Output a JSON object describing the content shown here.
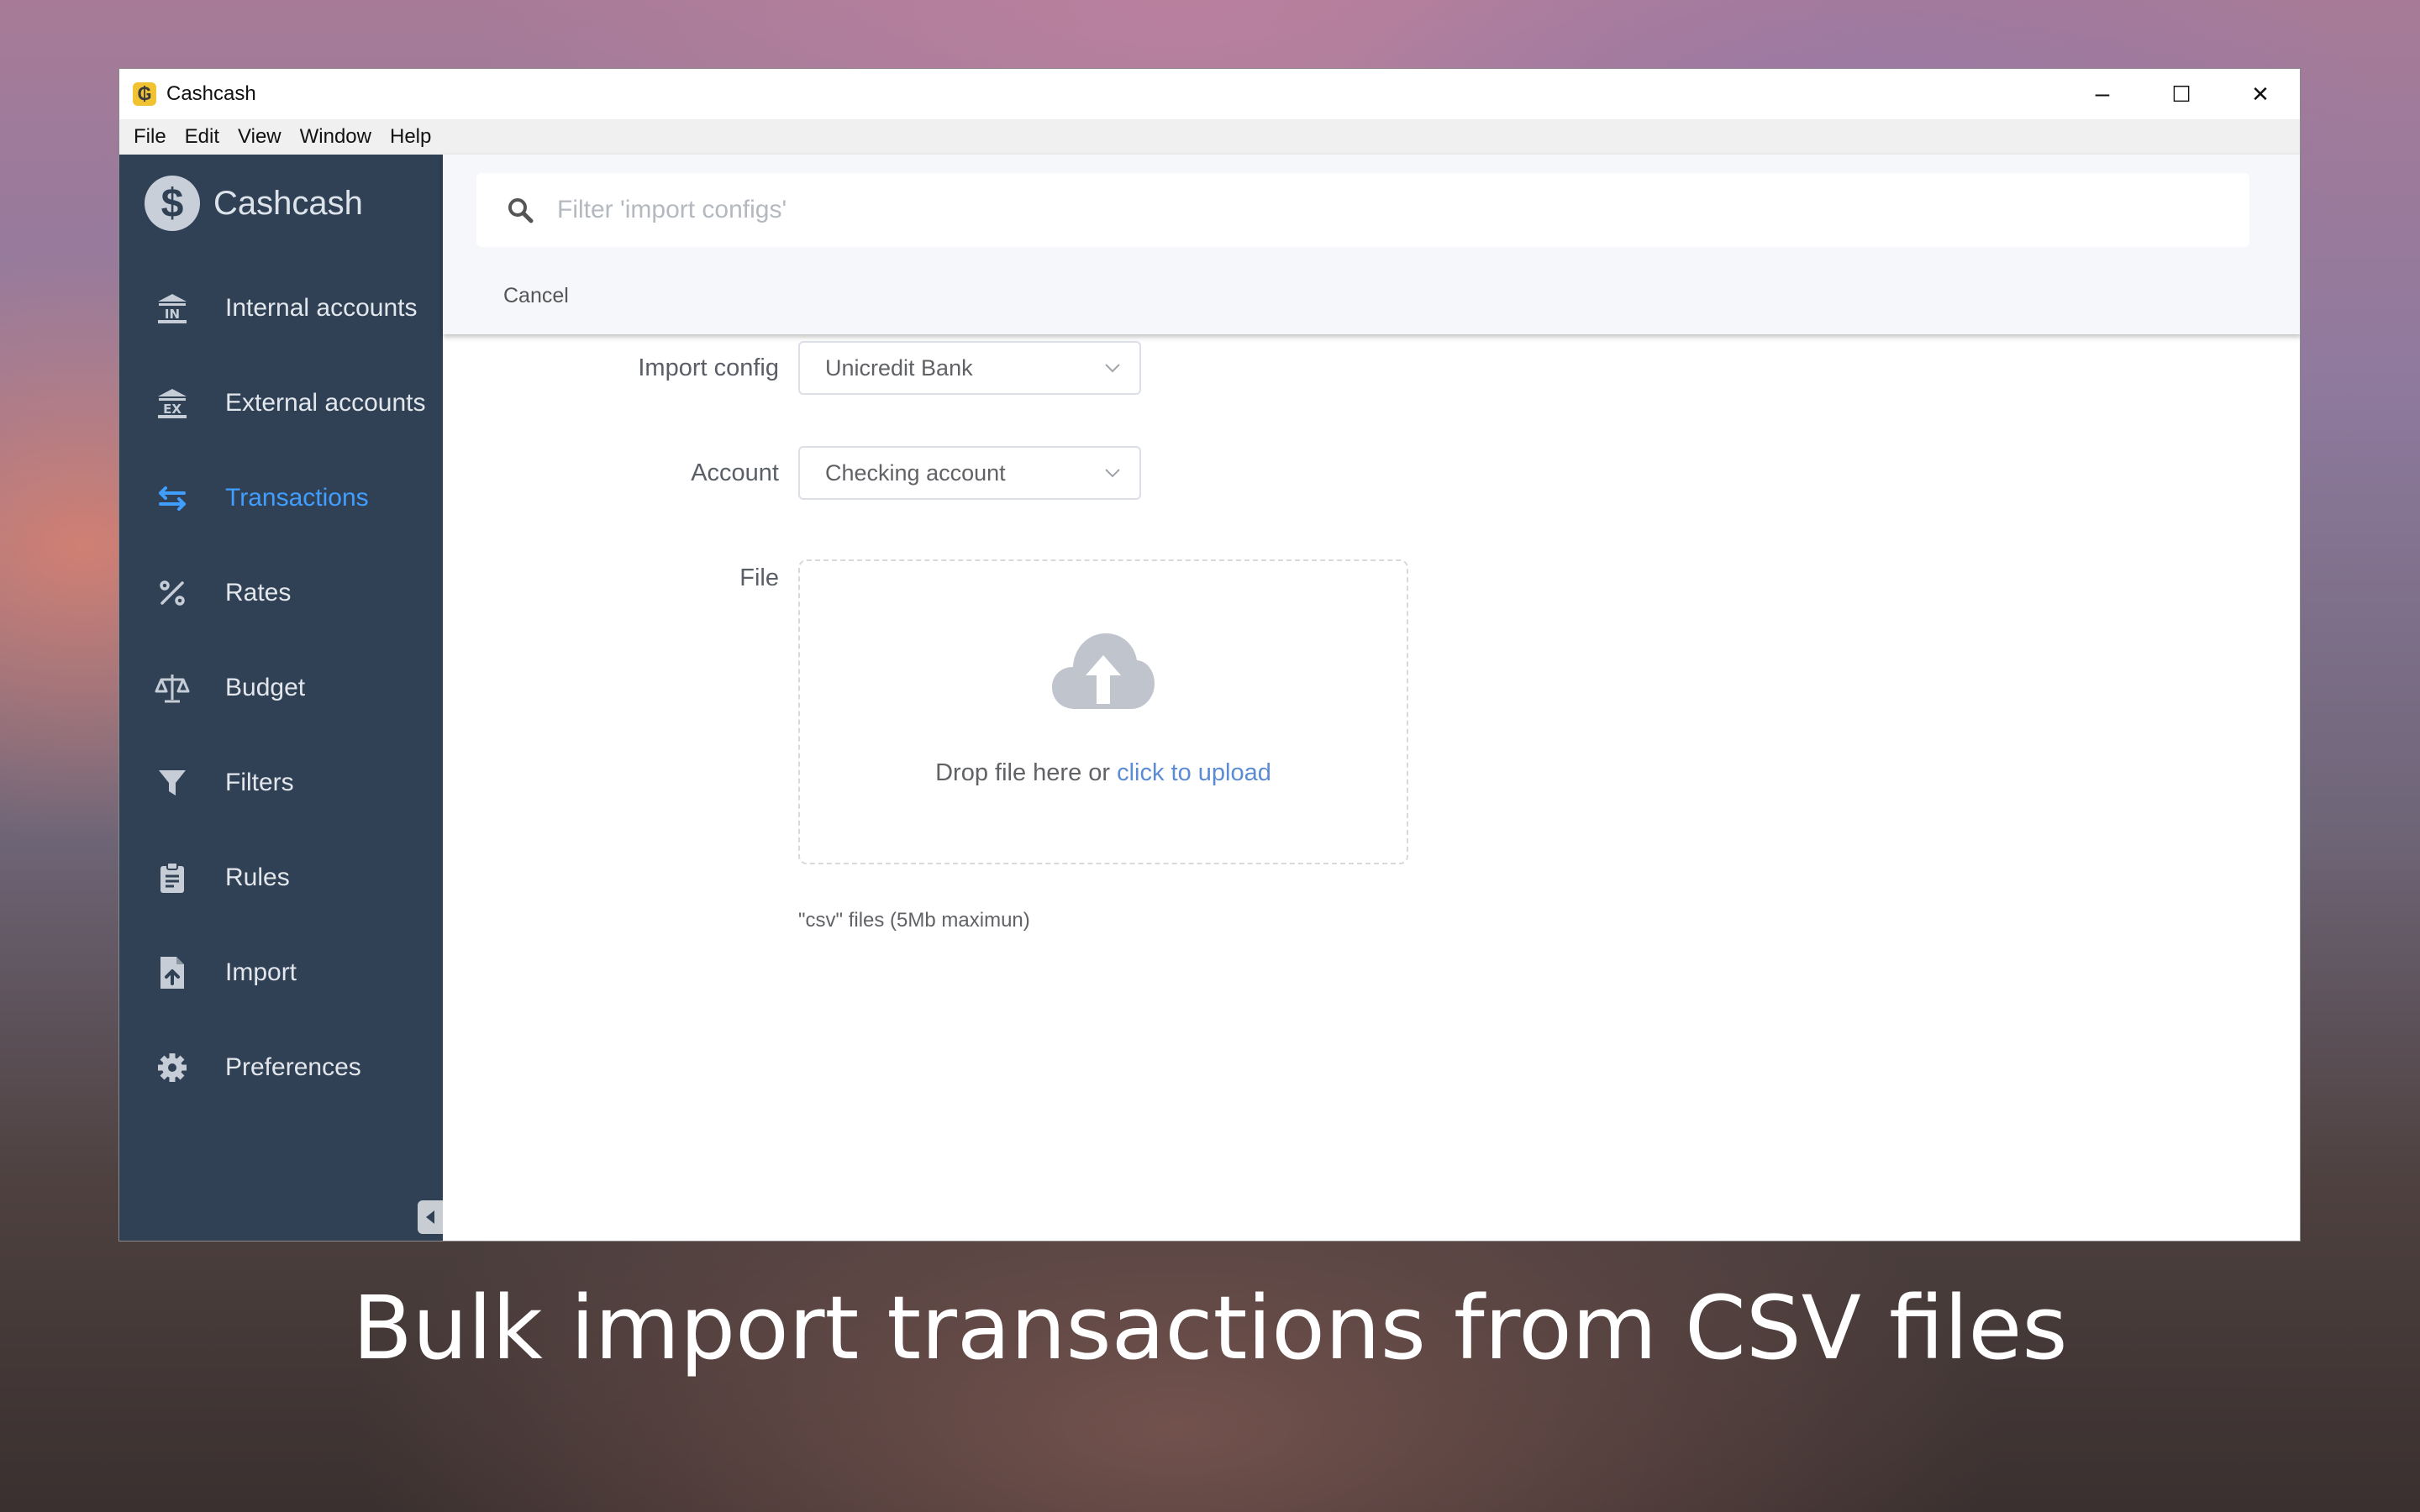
{
  "window": {
    "title": "Cashcash",
    "app_icon_glyph": "₲",
    "controls": {
      "minimize": "–",
      "maximize": "☐",
      "close": "✕"
    }
  },
  "menu": [
    "File",
    "Edit",
    "View",
    "Window",
    "Help"
  ],
  "sidebar": {
    "brand": "Cashcash",
    "items": [
      {
        "label": "Internal accounts",
        "icon": "bank-in-icon",
        "active": false
      },
      {
        "label": "External accounts",
        "icon": "bank-ex-icon",
        "active": false
      },
      {
        "label": "Transactions",
        "icon": "transfer-arrows-icon",
        "active": true
      },
      {
        "label": "Rates",
        "icon": "percent-icon",
        "active": false
      },
      {
        "label": "Budget",
        "icon": "scale-icon",
        "active": false
      },
      {
        "label": "Filters",
        "icon": "funnel-icon",
        "active": false
      },
      {
        "label": "Rules",
        "icon": "clipboard-icon",
        "active": false
      },
      {
        "label": "Import",
        "icon": "file-upload-icon",
        "active": false
      },
      {
        "label": "Preferences",
        "icon": "gear-icon",
        "active": false
      }
    ]
  },
  "search": {
    "placeholder": "Filter 'import configs'",
    "value": ""
  },
  "topbar": {
    "cancel_label": "Cancel"
  },
  "form": {
    "import_config_label": "Import config",
    "import_config_value": "Unicredit Bank",
    "account_label": "Account",
    "account_value": "Checking account",
    "file_label": "File",
    "upload_text": "Drop file here or ",
    "upload_link": "click to upload",
    "upload_tip": "\"csv\" files (5Mb maximun)"
  },
  "caption": "Bulk import transactions from CSV files",
  "colors": {
    "sidebar_bg": "#304156",
    "accent": "#409eff",
    "link": "#5b8bd4"
  }
}
